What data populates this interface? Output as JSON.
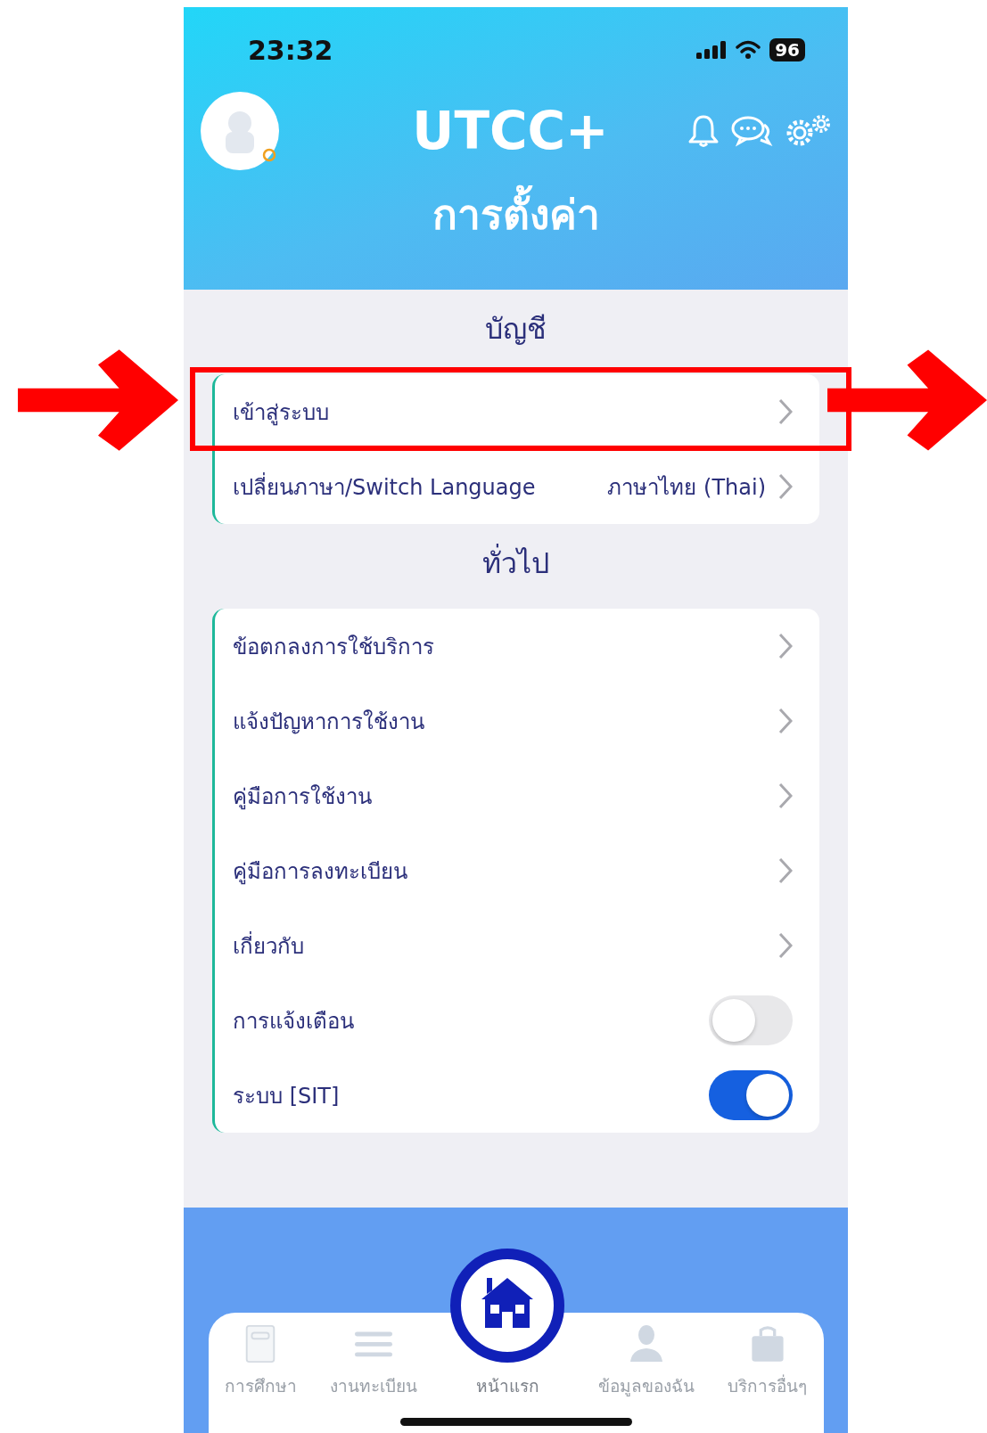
{
  "status_bar": {
    "time": "23:32",
    "battery": "96"
  },
  "header": {
    "app_name": "UTCC+",
    "title": "การตั้งค่า"
  },
  "sections": [
    {
      "title": "บัญชี",
      "items": [
        {
          "kind": "link",
          "label": "เข้าสู่ระบบ",
          "highlighted": true
        },
        {
          "kind": "link",
          "label": "เปลี่ยนภาษา/Switch Language",
          "value": "ภาษาไทย (Thai)",
          "highlighted": false
        }
      ]
    },
    {
      "title": "ทั่วไป",
      "items": [
        {
          "kind": "link",
          "label": "ข้อตกลงการใช้บริการ",
          "highlighted": false
        },
        {
          "kind": "link",
          "label": "แจ้งปัญหาการใช้งาน",
          "highlighted": false
        },
        {
          "kind": "link",
          "label": "คู่มือการใช้งาน",
          "highlighted": false
        },
        {
          "kind": "link",
          "label": "คู่มือการลงทะเบียน",
          "highlighted": false
        },
        {
          "kind": "link",
          "label": "เกี่ยวกับ",
          "highlighted": false
        },
        {
          "kind": "toggle",
          "label": "การแจ้งเตือน",
          "on": false,
          "highlighted": false
        },
        {
          "kind": "toggle",
          "label": "ระบบ [SIT]",
          "on": true,
          "highlighted": false
        }
      ]
    }
  ],
  "tab_bar": [
    {
      "kind": "book",
      "label": "การศึกษา",
      "selected": false
    },
    {
      "kind": "list",
      "label": "งานทะเบียน",
      "selected": false
    },
    {
      "kind": "home",
      "label": "หน้าแรก",
      "selected": true
    },
    {
      "kind": "person",
      "label": "ข้อมูลของฉัน",
      "selected": false
    },
    {
      "kind": "bag",
      "label": "บริการอื่นๆ",
      "selected": false
    }
  ]
}
